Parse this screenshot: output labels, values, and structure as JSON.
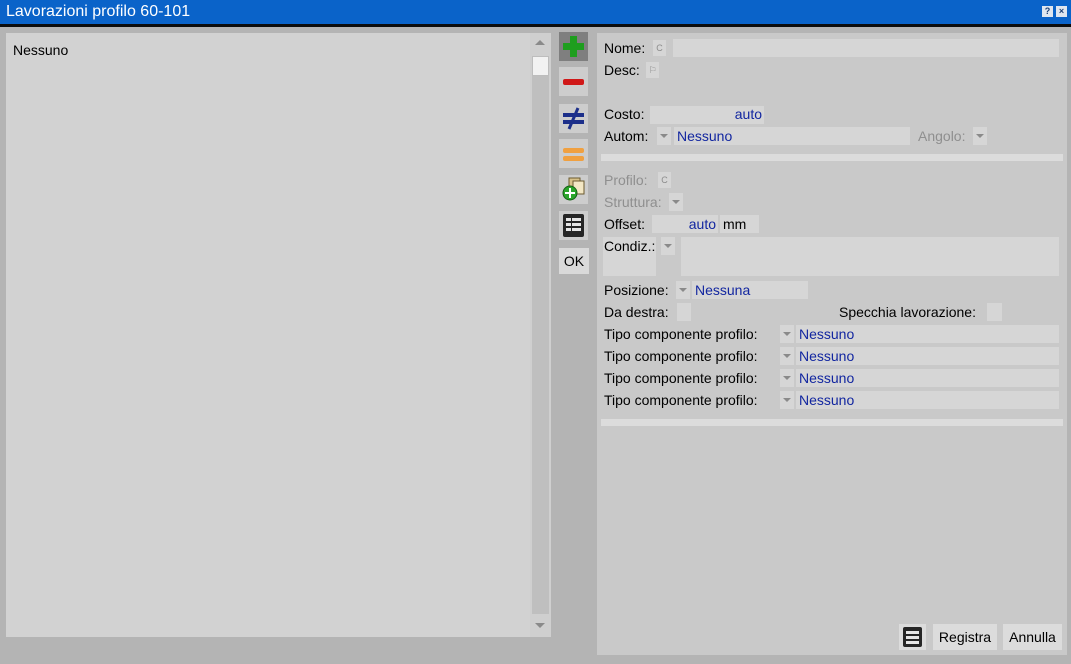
{
  "window": {
    "title": "Lavorazioni profilo 60-101"
  },
  "list": {
    "items": [
      "Nessuno"
    ]
  },
  "toolbar": {
    "ok_label": "OK"
  },
  "form": {
    "nome_label": "Nome:",
    "desc_label": "Desc:",
    "costo_label": "Costo:",
    "costo_value": "auto",
    "autom_label": "Autom:",
    "autom_value": "Nessuno",
    "angolo_label": "Angolo:",
    "profilo_label": "Profilo:",
    "struttura_label": "Struttura:",
    "offset_label": "Offset:",
    "offset_value": "auto",
    "offset_unit": "mm",
    "condiz_label": "Condiz.:",
    "posizione_label": "Posizione:",
    "posizione_value": "Nessuna",
    "da_destra_label": "Da destra:",
    "specchia_label": "Specchia lavorazione:",
    "tipo_componente": [
      {
        "label": "Tipo componente profilo:",
        "value": "Nessuno"
      },
      {
        "label": "Tipo componente profilo:",
        "value": "Nessuno"
      },
      {
        "label": "Tipo componente profilo:",
        "value": "Nessuno"
      },
      {
        "label": "Tipo componente profilo:",
        "value": "Nessuno"
      }
    ]
  },
  "footer": {
    "registra_label": "Registra",
    "annulla_label": "Annulla"
  },
  "icons": {
    "add": "plus-icon",
    "remove": "minus-icon",
    "not_equal": "not-equal-icon",
    "equal": "equal-icon",
    "copy_add": "copy-add-icon",
    "table": "table-icon"
  },
  "colors": {
    "titlebar": "#0a63c9",
    "value_text": "#1226a0",
    "add": "#1e9e1e",
    "remove": "#d01818",
    "equal": "#f0a040"
  }
}
